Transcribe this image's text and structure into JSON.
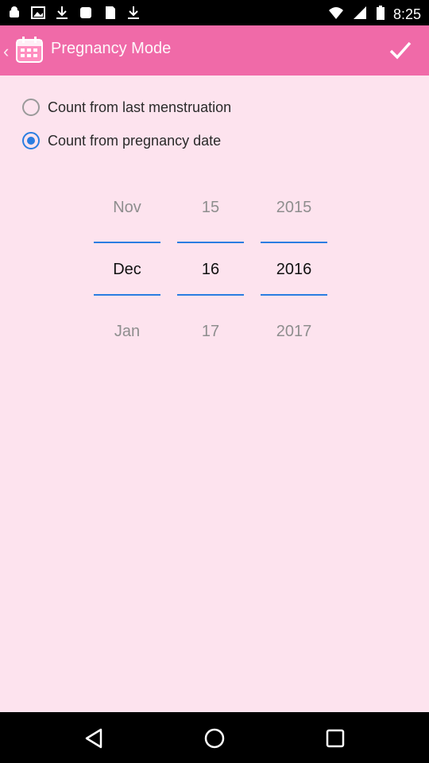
{
  "status": {
    "time": "8:25",
    "left_icons": [
      "android-icon",
      "image-icon",
      "download-icon",
      "notification-icon",
      "sd-card-icon",
      "download-icon"
    ],
    "right_icons": [
      "wifi-icon",
      "signal-icon",
      "battery-icon"
    ]
  },
  "appbar": {
    "title": "Pregnancy Mode",
    "bg_color": "#f06aa8"
  },
  "options": [
    {
      "label": "Count from last menstruation",
      "checked": false
    },
    {
      "label": "Count from pregnancy date",
      "checked": true
    }
  ],
  "picker": {
    "month": {
      "prev": "Nov",
      "current": "Dec",
      "next": "Jan"
    },
    "day": {
      "prev": "15",
      "current": "16",
      "next": "17"
    },
    "year": {
      "prev": "2015",
      "current": "2016",
      "next": "2017"
    }
  },
  "colors": {
    "background": "#fde3ee",
    "accent": "#2a7de1"
  }
}
